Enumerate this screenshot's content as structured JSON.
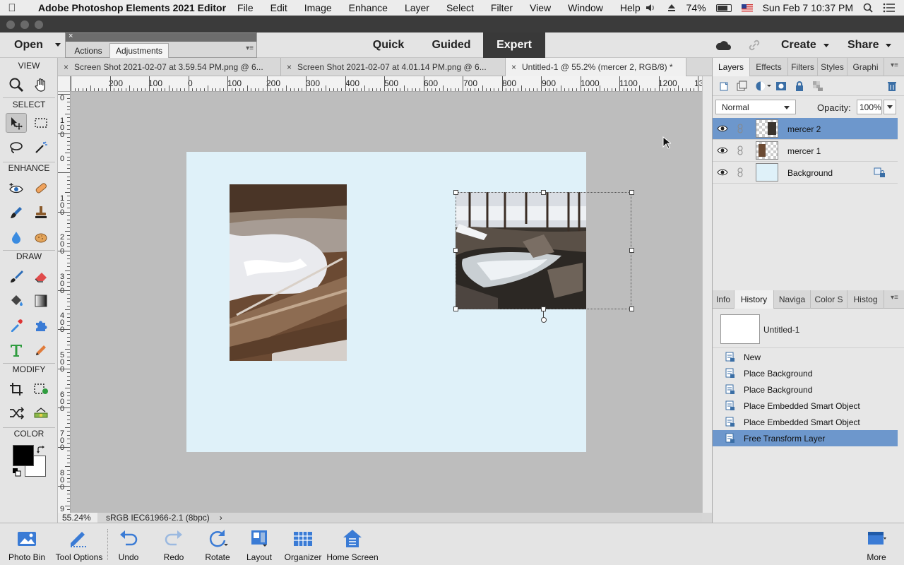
{
  "menubar": {
    "app_name": "Adobe Photoshop Elements 2021 Editor",
    "items": [
      "File",
      "Edit",
      "Image",
      "Enhance",
      "Layer",
      "Select",
      "Filter",
      "View",
      "Window",
      "Help"
    ],
    "battery": "74%",
    "clock": "Sun Feb 7  10:37 PM"
  },
  "appbar": {
    "open_label": "Open",
    "modes": [
      "Quick",
      "Guided",
      "Expert"
    ],
    "active_mode": "Expert",
    "create_label": "Create",
    "share_label": "Share"
  },
  "float_panel": {
    "tabs": [
      "Actions",
      "Adjustments"
    ],
    "active_tab": "Adjustments"
  },
  "toolbox": {
    "sections": [
      "VIEW",
      "SELECT",
      "ENHANCE",
      "DRAW",
      "MODIFY",
      "COLOR"
    ]
  },
  "doc_tabs": [
    {
      "label": "Screen Shot 2021-02-07 at 3.59.54 PM.png @ 6...",
      "active": false
    },
    {
      "label": "Screen Shot 2021-02-07 at 4.01.14 PM.png @ 6...",
      "active": false
    },
    {
      "label": "Untitled-1 @ 55.2% (mercer 2, RGB/8) *",
      "active": true
    }
  ],
  "rulers": {
    "h_labels": [
      "200",
      "100",
      "0",
      "100",
      "200",
      "300",
      "400",
      "500",
      "600",
      "700",
      "800",
      "900",
      "1000",
      "1100",
      "1200",
      "13"
    ],
    "v_labels": [
      "0",
      "100",
      "0",
      "100",
      "200",
      "300",
      "400",
      "500",
      "600",
      "700",
      "800",
      "9"
    ]
  },
  "statusbar": {
    "zoom": "55.24%",
    "profile": "sRGB IEC61966-2.1 (8bpc)"
  },
  "layers_panel": {
    "tabs": [
      "Layers",
      "Effects",
      "Filters",
      "Styles",
      "Graphi"
    ],
    "active_tab": "Layers",
    "blend_mode": "Normal",
    "opacity_label": "Opacity:",
    "opacity_value": "100%",
    "layers": [
      {
        "name": "mercer 2",
        "selected": true
      },
      {
        "name": "mercer 1",
        "selected": false
      },
      {
        "name": "Background",
        "selected": false
      }
    ]
  },
  "history_panel": {
    "tabs": [
      "Info",
      "History",
      "Naviga",
      "Color S",
      "Histog"
    ],
    "active_tab": "History",
    "doc_title": "Untitled-1",
    "steps": [
      {
        "name": "New",
        "selected": false
      },
      {
        "name": "Place Background",
        "selected": false
      },
      {
        "name": "Place Background",
        "selected": false
      },
      {
        "name": "Place Embedded Smart Object",
        "selected": false
      },
      {
        "name": "Place Embedded Smart Object",
        "selected": false
      },
      {
        "name": "Free Transform Layer",
        "selected": true
      }
    ]
  },
  "taskbar": {
    "buttons": [
      "Photo Bin",
      "Tool Options",
      "Undo",
      "Redo",
      "Rotate",
      "Layout",
      "Organizer",
      "Home Screen",
      "More"
    ]
  },
  "colors": {
    "canvas_bg": "#dff1f9",
    "workspace_bg": "#bdbdbd",
    "selection_blue": "#6d97cc",
    "active_mode_bg": "#393939"
  }
}
